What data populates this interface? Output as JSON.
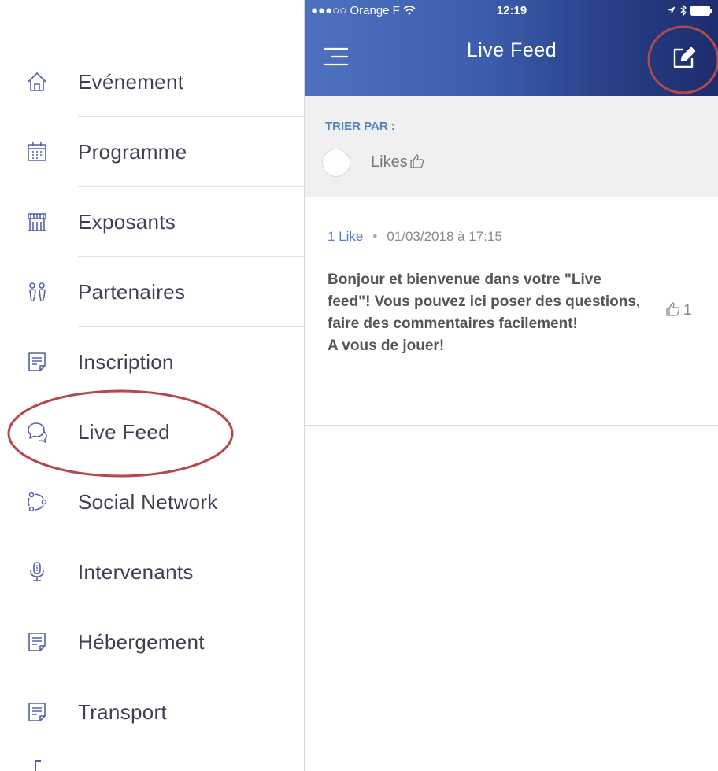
{
  "colors": {
    "accent": "#4e84c4",
    "header_gradient_start": "#4f72c0",
    "header_gradient_end": "#1c2d6e",
    "annotation": "#b5484a",
    "menu_text": "#3f3f53",
    "menu_icon": "#5560a8"
  },
  "menu": {
    "items": [
      {
        "label": "Evénement",
        "icon": "home-icon"
      },
      {
        "label": "Programme",
        "icon": "calendar-icon"
      },
      {
        "label": "Exposants",
        "icon": "stand-icon"
      },
      {
        "label": "Partenaires",
        "icon": "partners-icon"
      },
      {
        "label": "Inscription",
        "icon": "document-icon"
      },
      {
        "label": "Live Feed",
        "icon": "chat-bubbles-icon"
      },
      {
        "label": "Social Network",
        "icon": "network-icon"
      },
      {
        "label": "Intervenants",
        "icon": "microphone-icon"
      },
      {
        "label": "Hébergement",
        "icon": "document-icon"
      },
      {
        "label": "Transport",
        "icon": "document-icon"
      }
    ]
  },
  "status_bar": {
    "carrier": "●●●○○ Orange F",
    "time": "12:19"
  },
  "header": {
    "title": "Live Feed",
    "menu_icon": "hamburger-icon",
    "compose_icon": "compose-icon"
  },
  "sort": {
    "title": "TRIER PAR :",
    "option_label": "Likes"
  },
  "post": {
    "likes_text": "1 Like",
    "separator": "•",
    "date": "01/03/2018 à 17:15",
    "body": "Bonjour et bienvenue dans votre \"Live feed\"! Vous pouvez ici poser des questions, faire des commentaires facilement!\nA vous de jouer!",
    "like_count": "1"
  }
}
